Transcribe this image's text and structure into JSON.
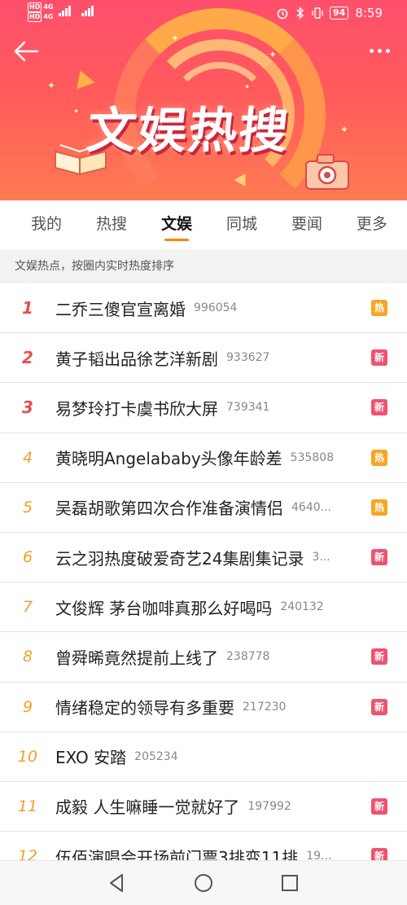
{
  "status_bar": {
    "left_top": "HD",
    "left_bottom": "HD",
    "net_top": "4G",
    "net_bottom": "4G",
    "battery": "94",
    "time": "8:59"
  },
  "hero": {
    "title": "文娱热搜",
    "colors": {
      "start": "#ff4f6c",
      "end": "#ff7a52",
      "accent": "#ffb347"
    }
  },
  "tabs": [
    {
      "label": "我的"
    },
    {
      "label": "热搜"
    },
    {
      "label": "文娱",
      "active": true
    },
    {
      "label": "同城"
    },
    {
      "label": "要闻"
    },
    {
      "label": "更多"
    }
  ],
  "subheader": "文娱热点，按圈内实时热度排序",
  "list": [
    {
      "rank": "1",
      "title": "二乔三傻官宣离婚",
      "heat": "996054",
      "badge": "热",
      "badge_type": "hot"
    },
    {
      "rank": "2",
      "title": "黄子韬出品徐艺洋新剧",
      "heat": "933627",
      "badge": "新",
      "badge_type": "new"
    },
    {
      "rank": "3",
      "title": "易梦玲打卡虞书欣大屏",
      "heat": "739341",
      "badge": "新",
      "badge_type": "new"
    },
    {
      "rank": "4",
      "title": "黄晓明Angelababy头像年龄差",
      "heat": "535808",
      "badge": "热",
      "badge_type": "hot"
    },
    {
      "rank": "5",
      "title": "吴磊胡歌第四次合作准备演情侣",
      "heat": "4640...",
      "badge": "热",
      "badge_type": "hot"
    },
    {
      "rank": "6",
      "title": "云之羽热度破爱奇艺24集剧集记录",
      "heat": "3...",
      "badge": "新",
      "badge_type": "new"
    },
    {
      "rank": "7",
      "title": "文俊辉 茅台咖啡真那么好喝吗",
      "heat": "240132",
      "badge": "",
      "badge_type": "none"
    },
    {
      "rank": "8",
      "title": "曾舜晞竟然提前上线了",
      "heat": "238778",
      "badge": "新",
      "badge_type": "new"
    },
    {
      "rank": "9",
      "title": "情绪稳定的领导有多重要",
      "heat": "217230",
      "badge": "新",
      "badge_type": "new"
    },
    {
      "rank": "10",
      "title": "EXO 安踏",
      "heat": "205234",
      "badge": "",
      "badge_type": "none"
    },
    {
      "rank": "11",
      "title": "成毅 人生嘛睡一觉就好了",
      "heat": "197992",
      "badge": "新",
      "badge_type": "new"
    },
    {
      "rank": "12",
      "title": "伍佰演唱会开场前门票3排变11排",
      "heat": "19...",
      "badge": "新",
      "badge_type": "new"
    }
  ],
  "nav": {
    "back": "back-triangle-icon",
    "home": "home-circle-icon",
    "recents": "recents-square-icon"
  }
}
